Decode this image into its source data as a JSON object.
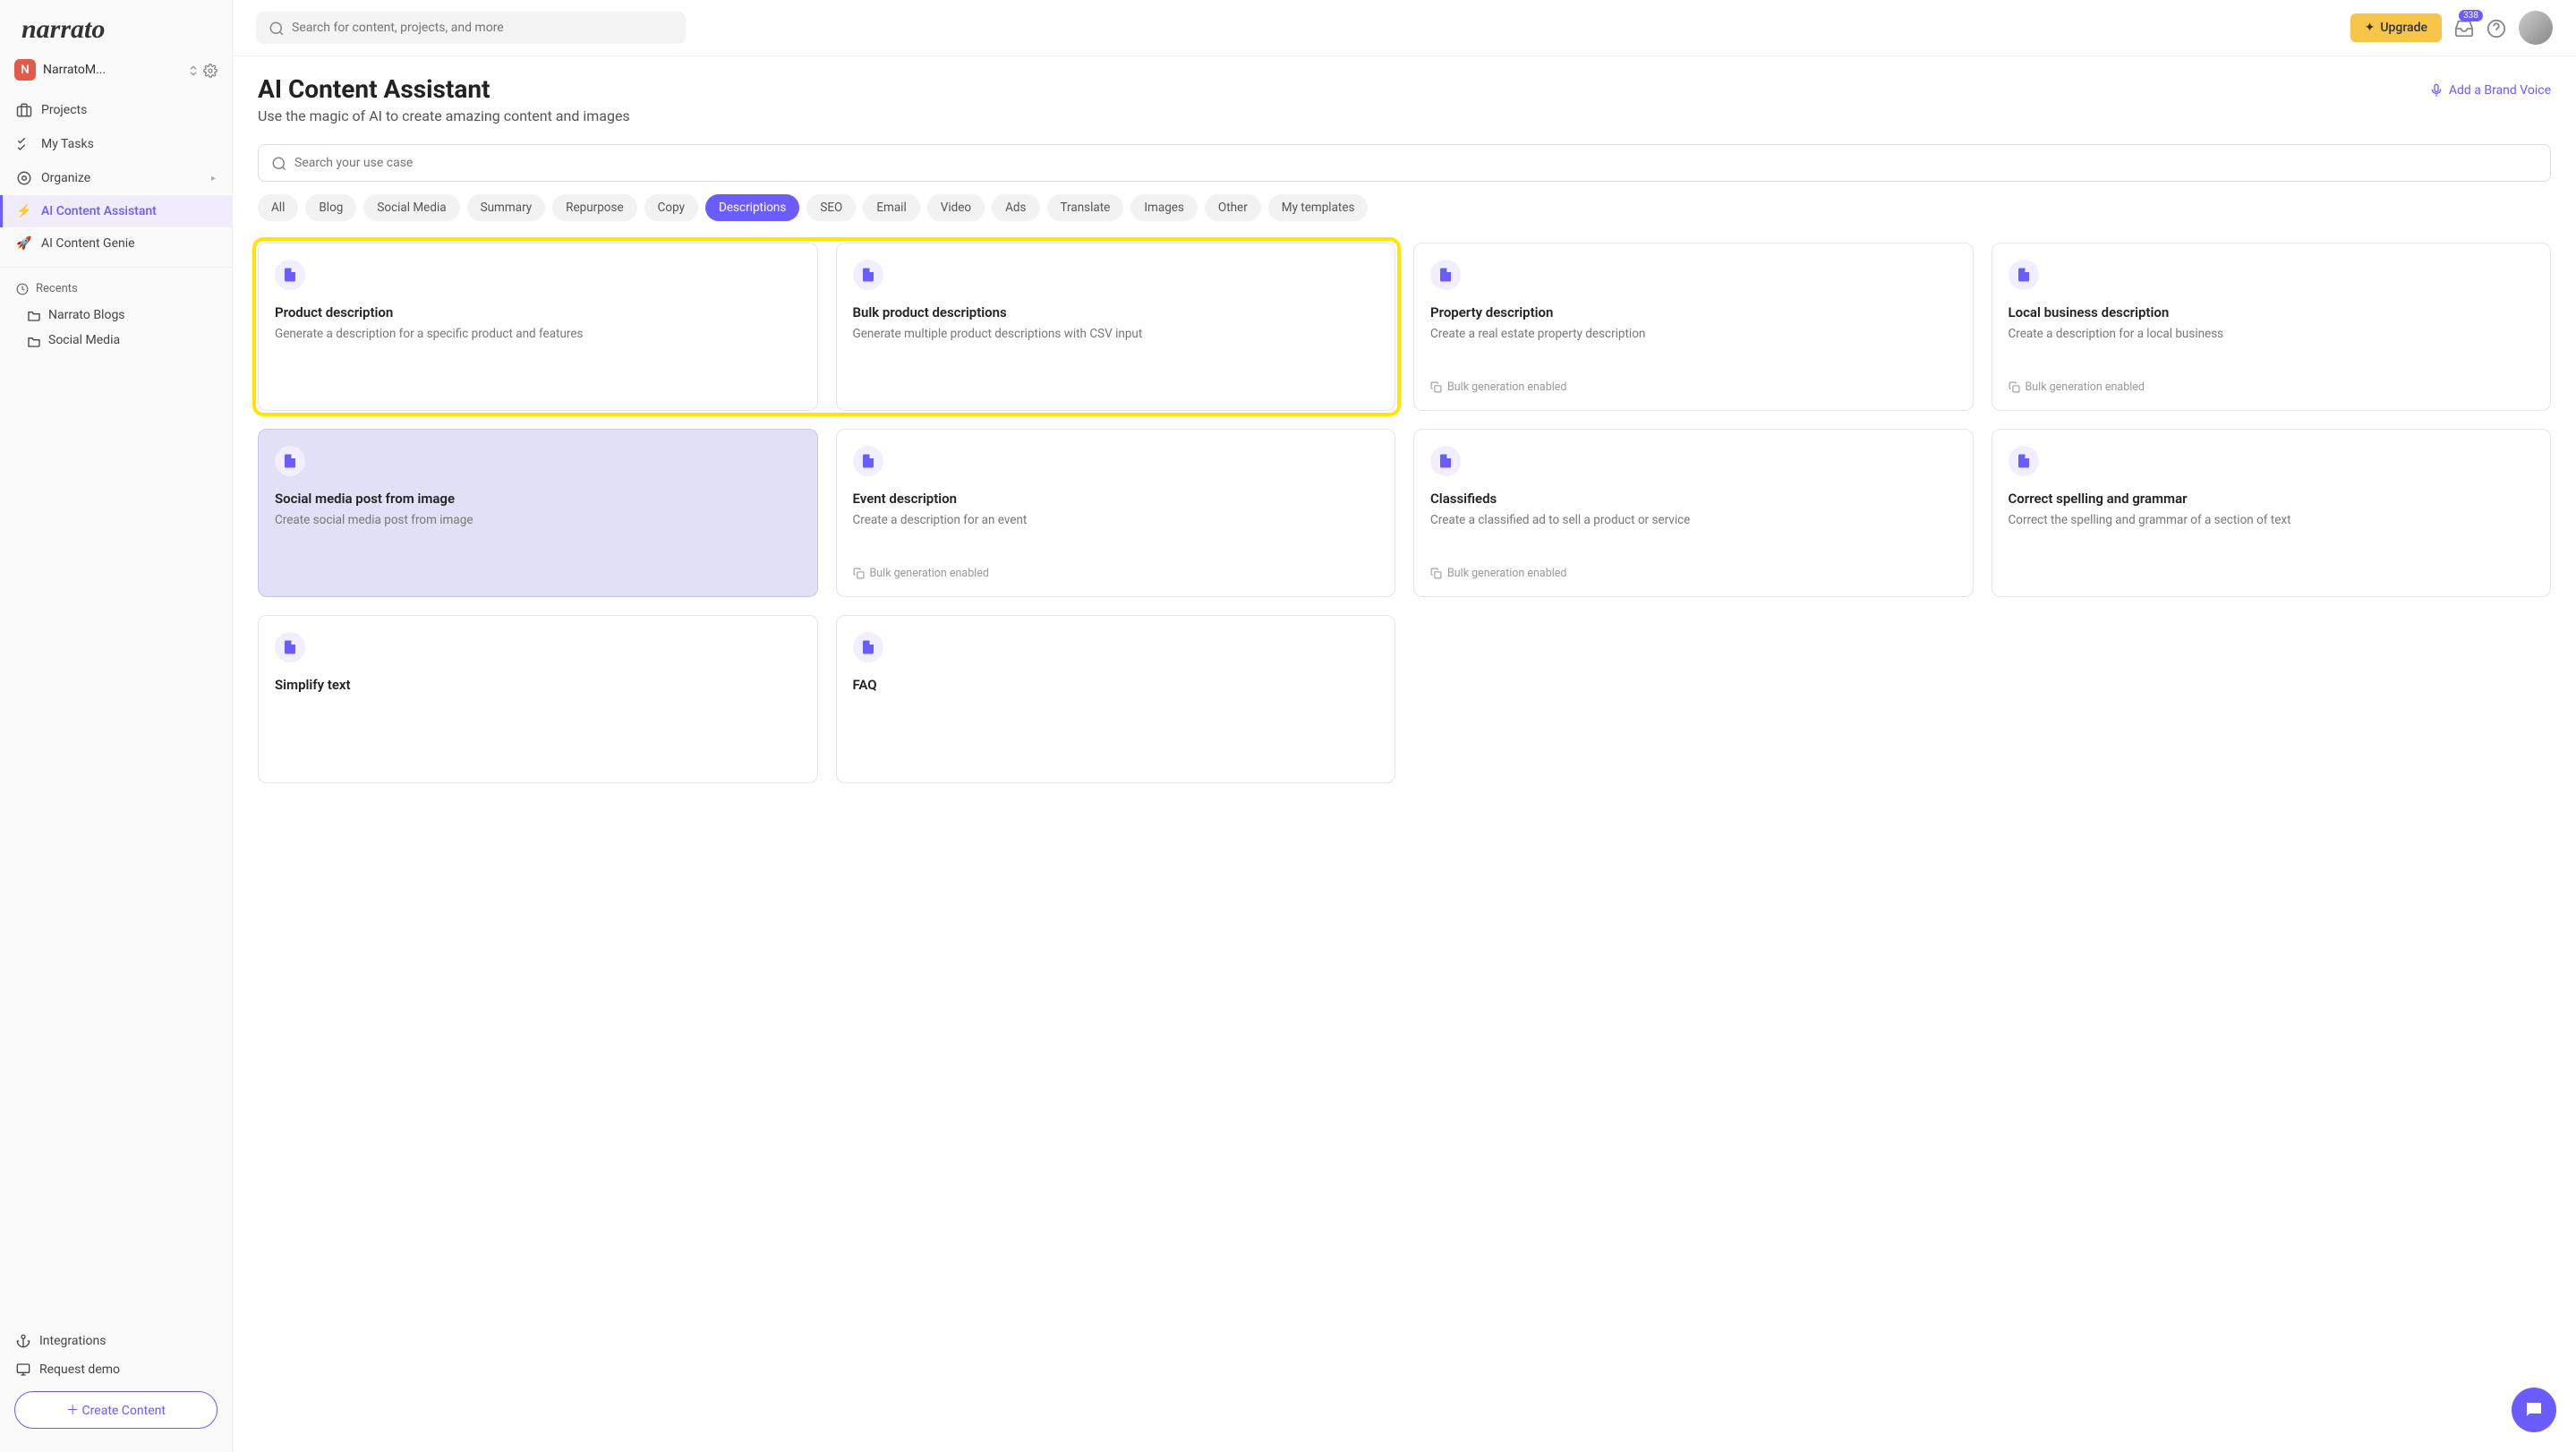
{
  "brand": "narrato",
  "workspace": {
    "initial": "N",
    "name": "NarratoM..."
  },
  "nav": {
    "projects": "Projects",
    "my_tasks": "My Tasks",
    "organize": "Organize",
    "ai_assistant": "AI Content Assistant",
    "ai_genie": "AI Content Genie"
  },
  "recents": {
    "header": "Recents",
    "items": [
      "Narrato Blogs",
      "Social Media"
    ]
  },
  "sidebar_bottom": {
    "integrations": "Integrations",
    "request_demo": "Request demo",
    "create_content": "Create Content"
  },
  "topbar": {
    "search_placeholder": "Search for content, projects, and more",
    "upgrade": "Upgrade",
    "notif_count": "338"
  },
  "page": {
    "title": "AI Content Assistant",
    "subtitle": "Use the magic of AI to create amazing content and images",
    "brand_voice": "Add a Brand Voice",
    "usecase_placeholder": "Search your use case"
  },
  "filters": [
    "All",
    "Blog",
    "Social Media",
    "Summary",
    "Repurpose",
    "Copy",
    "Descriptions",
    "SEO",
    "Email",
    "Video",
    "Ads",
    "Translate",
    "Images",
    "Other",
    "My templates"
  ],
  "active_filter": "Descriptions",
  "cards": [
    {
      "title": "Product description",
      "desc": "Generate a description for a specific product and features",
      "bulk": false,
      "hl": true
    },
    {
      "title": "Bulk product descriptions",
      "desc": "Generate multiple product descriptions with CSV input",
      "bulk": false,
      "hl": true
    },
    {
      "title": "Property description",
      "desc": "Create a real estate property description",
      "bulk": true
    },
    {
      "title": "Local business description",
      "desc": "Create a description for a local business",
      "bulk": true
    },
    {
      "title": "Social media post from image",
      "desc": "Create social media post from image",
      "bulk": false,
      "selected": true
    },
    {
      "title": "Event description",
      "desc": "Create a description for an event",
      "bulk": true
    },
    {
      "title": "Classifieds",
      "desc": "Create a classified ad to sell a product or service",
      "bulk": true
    },
    {
      "title": "Correct spelling and grammar",
      "desc": "Correct the spelling and grammar of a section of text",
      "bulk": false
    },
    {
      "title": "Simplify text",
      "desc": "",
      "bulk": false
    },
    {
      "title": "FAQ",
      "desc": "",
      "bulk": false
    }
  ],
  "bulk_label": "Bulk generation enabled"
}
